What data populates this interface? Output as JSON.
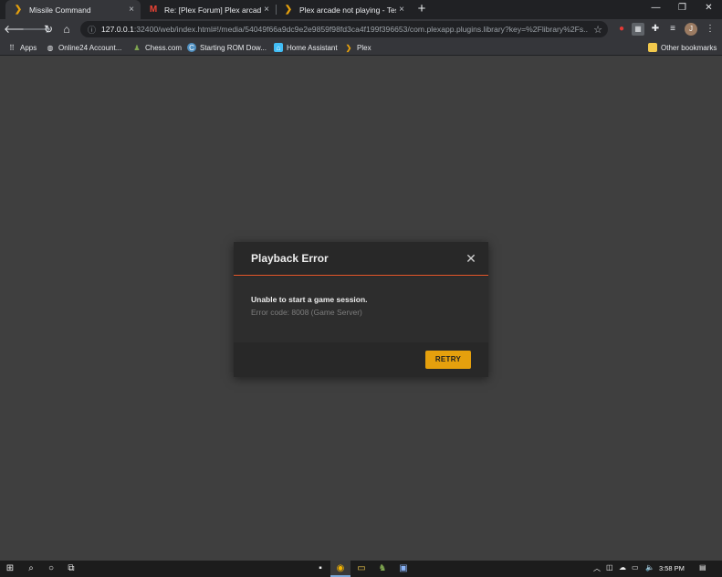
{
  "browser": {
    "tabs": [
      {
        "title": "Missile Command",
        "favicon": "plex-chevron-icon",
        "close": "×"
      },
      {
        "title": "Re: [Plex Forum] Plex arcade not",
        "favicon": "gmail-icon",
        "close": "×"
      },
      {
        "title": "Plex arcade not playing - Testing",
        "favicon": "plex-chevron-icon",
        "close": "×"
      }
    ],
    "new_tab": "+",
    "window_controls": {
      "minimize": "—",
      "restore": "❐",
      "close": "✕"
    },
    "url_host": "127.0.0.1",
    "url_rest": ":32400/web/index.html#!/media/54049f66a9dc9e2e9859f98fd3ca4f199f396653/com.plexapp.plugins.library?key=%2Flibrary%2Fs...",
    "avatar_letter": "J",
    "bookmarks": [
      {
        "label": "Apps",
        "icon": "apps-grid-icon"
      },
      {
        "label": "Online24 Account...",
        "icon": "online24-icon"
      },
      {
        "label": "Chess.com",
        "icon": "chess-pawn-icon"
      },
      {
        "label": "Starting ROM Dow...",
        "icon": "rom-icon"
      },
      {
        "label": "Home Assistant",
        "icon": "home-assistant-icon"
      },
      {
        "label": "Plex",
        "icon": "plex-chevron-icon"
      }
    ],
    "other_bookmarks": "Other bookmarks"
  },
  "modal": {
    "title": "Playback Error",
    "close": "✕",
    "message": "Unable to start a game session.",
    "error_code": "Error code: 8008 (Game Server)",
    "retry_label": "RETRY"
  },
  "taskbar": {
    "clock": "3:58 PM"
  },
  "colors": {
    "accent": "#e5a00d",
    "divider": "#e5582b",
    "background": "#3f3f3f"
  }
}
